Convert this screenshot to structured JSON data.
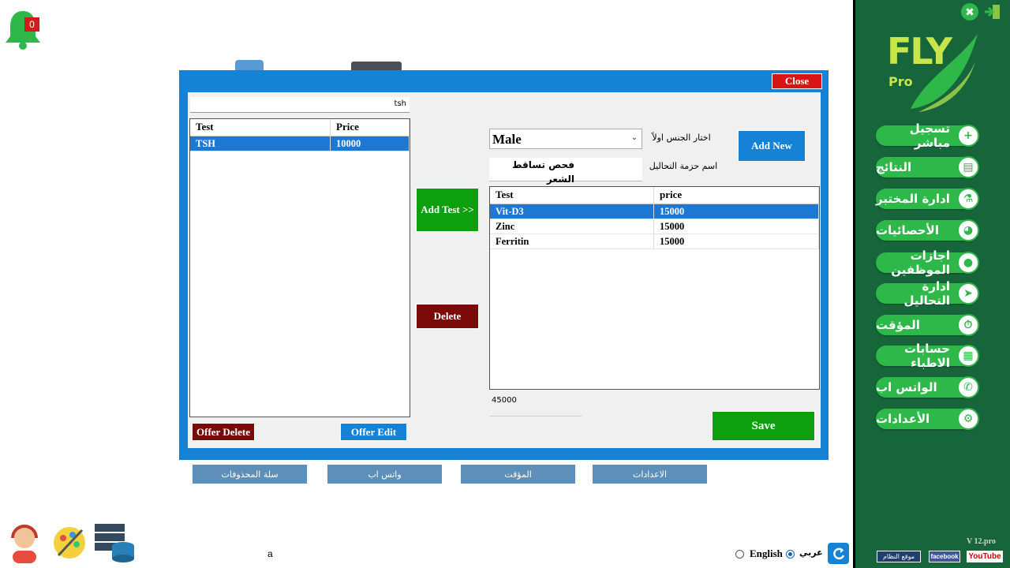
{
  "notifications": {
    "count": "0"
  },
  "dialog": {
    "close_label": "Close",
    "search_value": "tsh",
    "left_grid": {
      "columns": [
        "Test",
        "Price"
      ],
      "rows": [
        {
          "test": "TSH",
          "price": "10000"
        }
      ]
    },
    "add_test_label": "Add Test >>",
    "delete_label": "Delete",
    "offer_delete_label": "Offer Delete",
    "offer_edit_label": "Offer Edit",
    "gender_value": "Male",
    "gender_label": "اختار الجنس اولاً",
    "package_name_value": "فحص تساقط الشعر",
    "package_name_label": "اسم حزمة التحاليل",
    "add_new_label": "Add New",
    "right_grid": {
      "columns": [
        "Test",
        "price"
      ],
      "rows": [
        {
          "test": "Vit-D3",
          "price": "15000"
        },
        {
          "test": "Zinc",
          "price": "15000"
        },
        {
          "test": "Ferritin",
          "price": "15000"
        }
      ]
    },
    "total_value": "45000",
    "save_label": "Save"
  },
  "bottom_tabs": [
    "سلة المحذوفات",
    "واتس اب",
    "المؤقت",
    "الاعدادات"
  ],
  "sidebar": {
    "logo_text": "FLY",
    "logo_sub": "Pro",
    "items": [
      {
        "label": "تسجيل مباشر",
        "icon": "plus-icon"
      },
      {
        "label": "النتائج",
        "icon": "results-icon"
      },
      {
        "label": "ادارة المختبر",
        "icon": "lab-icon"
      },
      {
        "label": "الأحصائيات",
        "icon": "stats-icon"
      },
      {
        "label": "اجازات الموظفين",
        "icon": "location-icon"
      },
      {
        "label": "ادارة التحاليل",
        "icon": "send-icon"
      },
      {
        "label": "المؤقت",
        "icon": "timer-icon"
      },
      {
        "label": "حسابات الاطباء",
        "icon": "report-icon"
      },
      {
        "label": "الواتس اب",
        "icon": "whatsapp-icon"
      },
      {
        "label": "الأعدادات",
        "icon": "gear-icon"
      }
    ],
    "version": "V 12.pro",
    "footer_links": [
      "موقع النظام",
      "facebook",
      "YouTube"
    ]
  },
  "language": {
    "english": "English",
    "arabic": "عربي",
    "selected": "arabic"
  },
  "status_char": "a",
  "colors": {
    "accent_blue": "#1582d6",
    "sidebar_green": "#17663b",
    "pill_green": "#2fb84a",
    "dark_red": "#7a0a0a",
    "save_green": "#0e9f0e"
  }
}
